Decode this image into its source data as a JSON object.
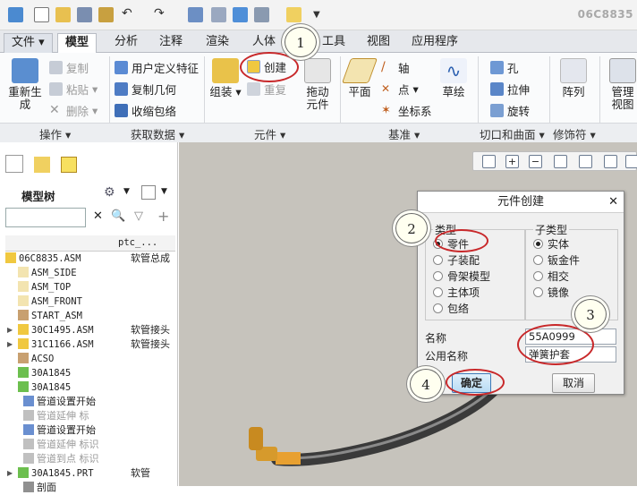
{
  "doc_id": "06C8835",
  "tabs": [
    "文件",
    "模型",
    "分析",
    "注释",
    "渲染",
    "人体",
    "工具",
    "视图",
    "应用程序"
  ],
  "ribbon": {
    "regen": "重新生成",
    "copy": "复制",
    "paste": "粘贴",
    "delete": "删除",
    "user_feature": "用户定义特征",
    "copy_geom": "复制几何",
    "shrinkwrap": "收缩包络",
    "assemble": "组装",
    "create": "创建",
    "repeat": "重复",
    "drag": "拖动元件",
    "plane": "平面",
    "axis": "轴",
    "point": "点",
    "csys": "坐标系",
    "sketch": "草绘",
    "hole": "孔",
    "extrude": "拉伸",
    "revolve": "旋转",
    "pattern": "阵列",
    "manage_views": "管理视图"
  },
  "groups": [
    "操作",
    "获取数据",
    "元件",
    "基准",
    "切口和曲面",
    "修饰符"
  ],
  "left_panel": {
    "title": "模型树",
    "col_header": "ptc_...",
    "rows": [
      {
        "name": "06C8835.ASM",
        "col": "软管总成"
      },
      {
        "name": "ASM_SIDE",
        "col": ""
      },
      {
        "name": "ASM_TOP",
        "col": ""
      },
      {
        "name": "ASM_FRONT",
        "col": ""
      },
      {
        "name": "START_ASM",
        "col": ""
      },
      {
        "name": "30C1495.ASM",
        "col": "软管接头"
      },
      {
        "name": "31C1166.ASM",
        "col": "软管接头"
      },
      {
        "name": "ACSO",
        "col": ""
      },
      {
        "name": "30A1845",
        "col": ""
      },
      {
        "name": "30A1845",
        "col": ""
      },
      {
        "name": "管道设置开始",
        "col": ""
      },
      {
        "name": "管道延伸 标",
        "col": ""
      },
      {
        "name": "管道设置开始",
        "col": ""
      },
      {
        "name": "管道延伸 标识",
        "col": ""
      },
      {
        "name": "管道到点 标识",
        "col": ""
      },
      {
        "name": "30A1845.PRT",
        "col": "软管"
      },
      {
        "name": "剖面",
        "col": ""
      }
    ]
  },
  "dialog": {
    "title": "元件创建",
    "type_label": "类型",
    "types": [
      "零件",
      "子装配",
      "骨架模型",
      "主体项",
      "包络"
    ],
    "subtype_label": "子类型",
    "subtypes": [
      "实体",
      "钣金件",
      "相交",
      "镜像"
    ],
    "name_label": "名称",
    "name_value": "55A0999",
    "common_label": "公用名称",
    "common_value": "弹簧护套",
    "ok": "确定",
    "cancel": "取消"
  },
  "callouts": [
    "1",
    "2",
    "3",
    "4"
  ]
}
